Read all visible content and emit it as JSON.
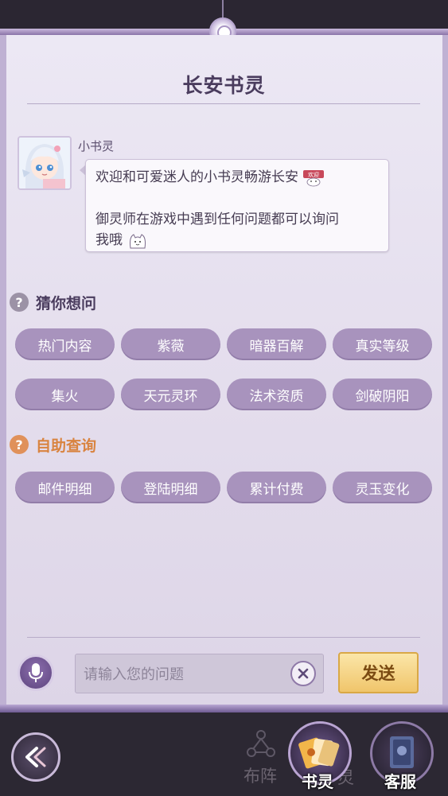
{
  "dialog": {
    "title": "长安书灵",
    "sender_name": "小书灵",
    "message_line1": "欢迎和可爱迷人的小书灵畅游长安",
    "sticker_welcome_text": "欢迎",
    "message_line2": "御灵师在游戏中遇到任何问题都可以询问",
    "message_line3": "我哦"
  },
  "guess_section": {
    "title": "猜你想问",
    "icon": "question-icon",
    "chips": [
      "热门内容",
      "紫薇",
      "暗器百解",
      "真实等级",
      "集火",
      "天元灵环",
      "法术资质",
      "剑破阴阳"
    ]
  },
  "self_query_section": {
    "title": "自助查询",
    "icon": "question-icon",
    "chips": [
      "邮件明细",
      "登陆明细",
      "累计付费",
      "灵玉变化"
    ]
  },
  "input_bar": {
    "placeholder": "请输入您的问题",
    "send_label": "发送"
  },
  "bottom_nav": {
    "items": [
      {
        "label": "布阵",
        "active": false
      },
      {
        "label": "书灵",
        "active": true
      },
      {
        "label": "客服",
        "active": false
      }
    ],
    "ghost_fragment": "灵"
  },
  "colors": {
    "chip_purple": "#a893bd",
    "guess_icon": "#9c92a6",
    "self_query_title": "#d98440",
    "send_gold": "#f0c56b"
  }
}
